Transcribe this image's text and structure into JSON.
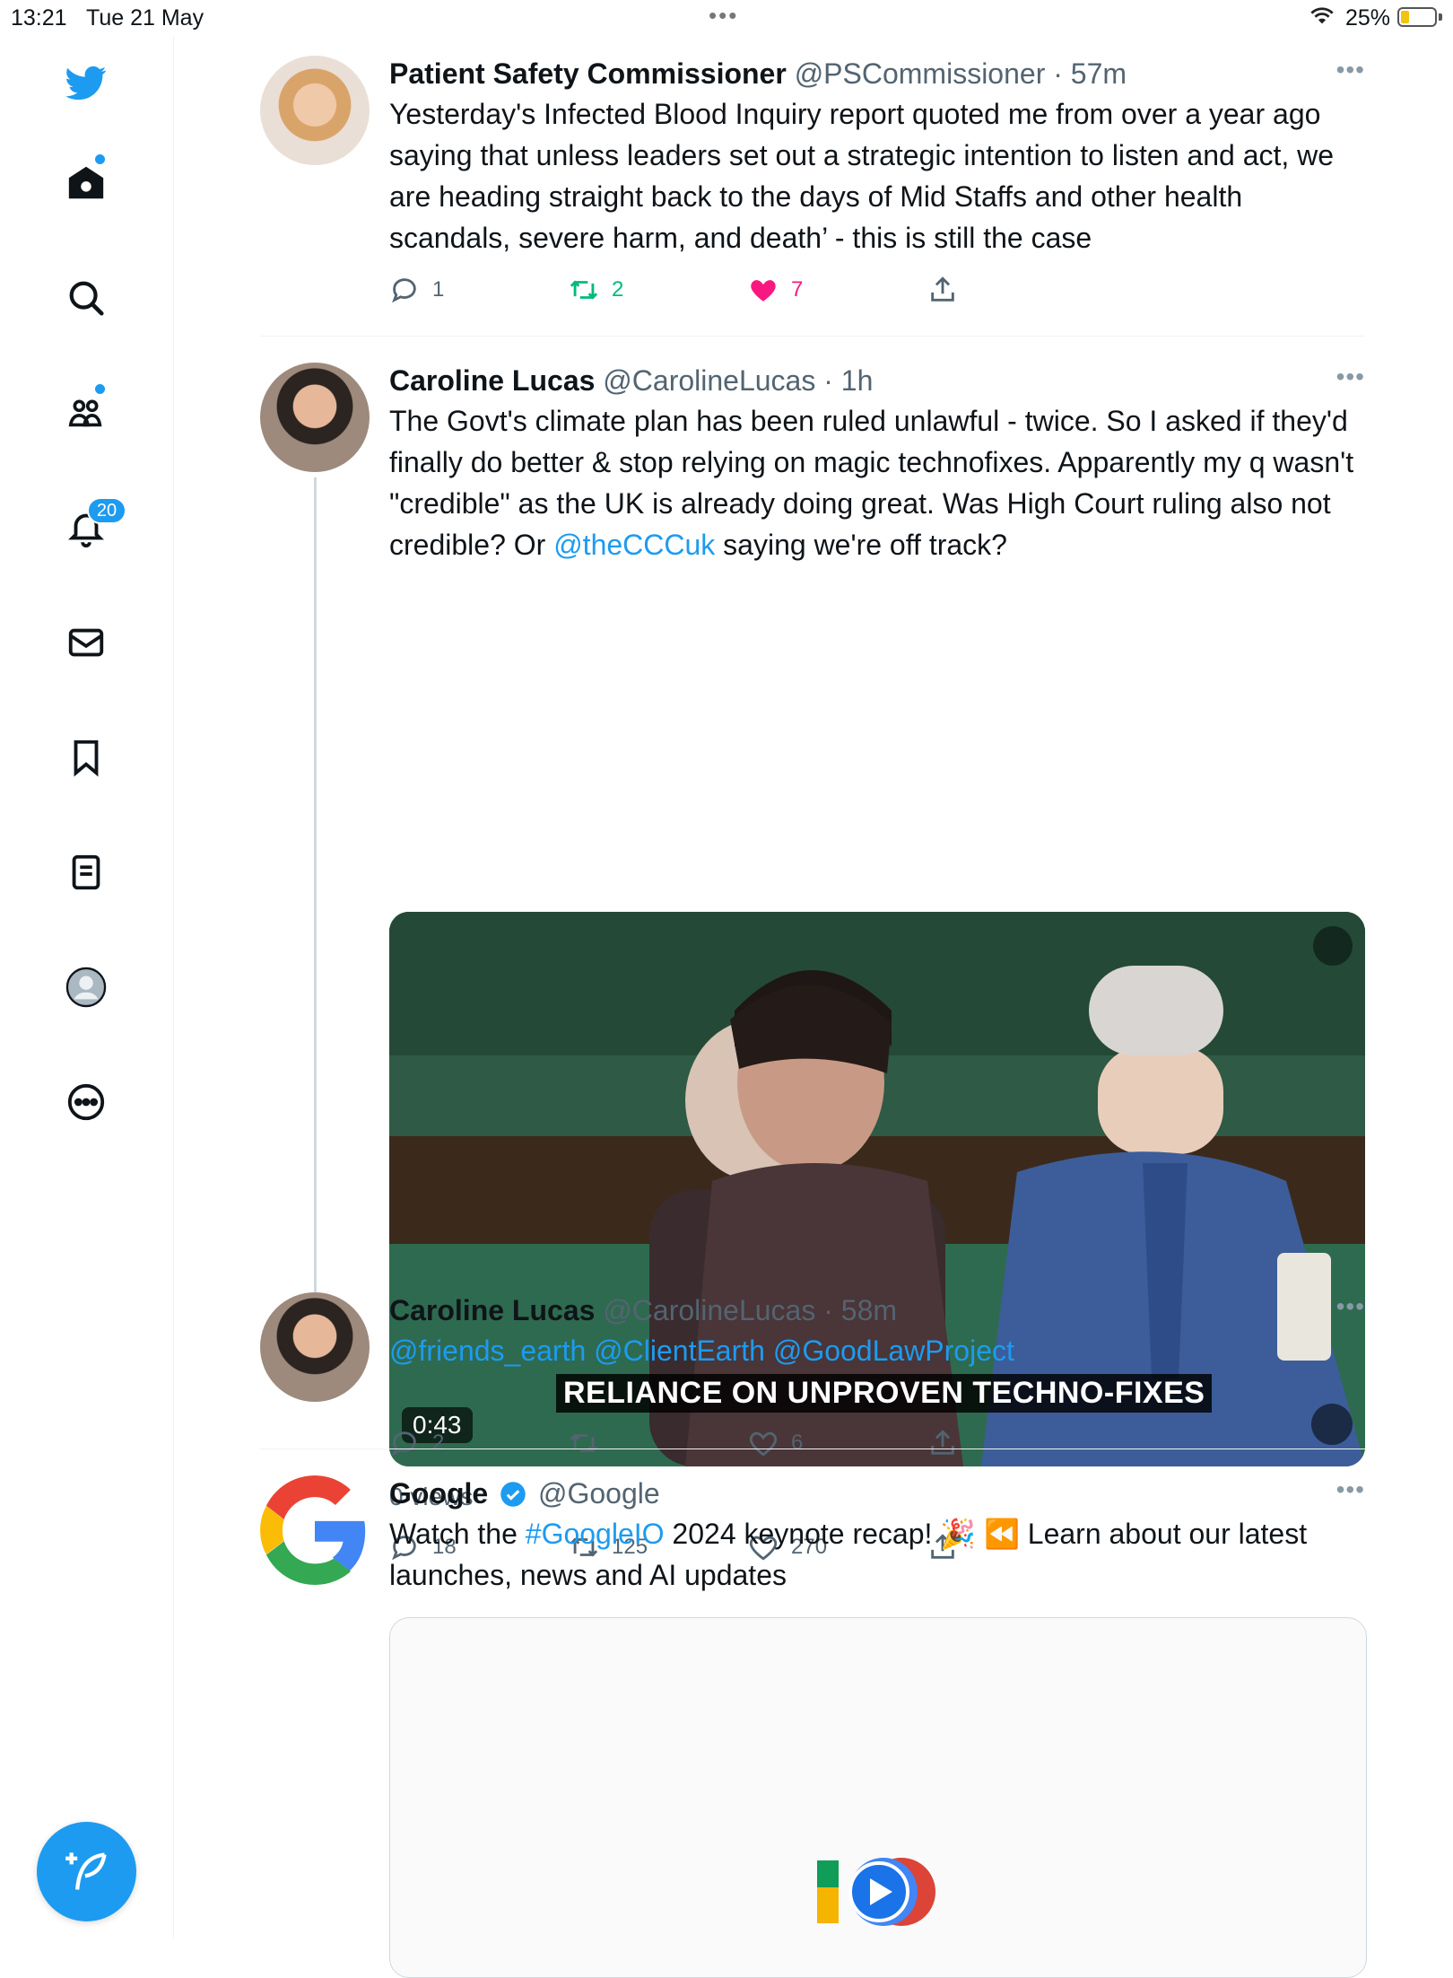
{
  "status_bar": {
    "time": "13:21",
    "date": "Tue 21 May",
    "battery": "25%",
    "battery_level": 0.25
  },
  "sidebar": {
    "items": [
      {
        "icon": "twitter-bird-icon"
      },
      {
        "icon": "home-icon"
      },
      {
        "icon": "search-icon"
      },
      {
        "icon": "communities-icon"
      },
      {
        "icon": "notifications-icon",
        "badge": "20"
      },
      {
        "icon": "messages-icon"
      },
      {
        "icon": "bookmarks-icon"
      },
      {
        "icon": "lists-icon"
      },
      {
        "icon": "profile-icon"
      },
      {
        "icon": "more-icon"
      }
    ],
    "compose_icon": "compose-icon"
  },
  "tweets": [
    {
      "name": "Patient Safety Commissioner",
      "handle": "@PSCommissioner",
      "time": "· 57m",
      "text": "Yesterday's Infected Blood Inquiry report quoted me  from over a year ago saying that unless leaders set out a strategic intention to listen and act, we are heading straight back to the days of Mid Staffs and other health scandals, severe harm, and death’ - this is still the case",
      "replies": "1",
      "retweets": "2",
      "likes": "7"
    },
    {
      "name": "Caroline Lucas",
      "handle": "@CarolineLucas",
      "time": "· 1h",
      "text_before": "The Govt's climate plan has been ruled unlawful - twice. So I asked if they'd finally do better & stop relying on magic technofixes. Apparently my q wasn't \"credible\" as the UK is already doing great. Was High Court ruling also not credible? Or ",
      "mention": "@theCCCuk",
      "text_after": " saying we're off track?",
      "video": {
        "caption": "RELIANCE ON UNPROVEN TECHNO-FIXES",
        "duration": "0:43"
      },
      "views": "0 views",
      "replies": "18",
      "retweets": "125",
      "likes": "270"
    },
    {
      "name": "Caroline Lucas",
      "handle": "@CarolineLucas",
      "time": "· 58m",
      "mentions": "@friends_earth @ClientEarth @GoodLawProject",
      "replies": "2",
      "retweets": "",
      "likes": "6"
    },
    {
      "name": "Google",
      "handle": "@Google",
      "text_before": "Watch the ",
      "hashtag": "#GoogleIO",
      "text_after": " 2024 keynote recap! 🎉 ⏪ Learn about our latest launches, news and AI updates"
    }
  ],
  "colors": {
    "accent": "#1d9bf0",
    "retweet": "#00ba7c",
    "like": "#f91880"
  }
}
